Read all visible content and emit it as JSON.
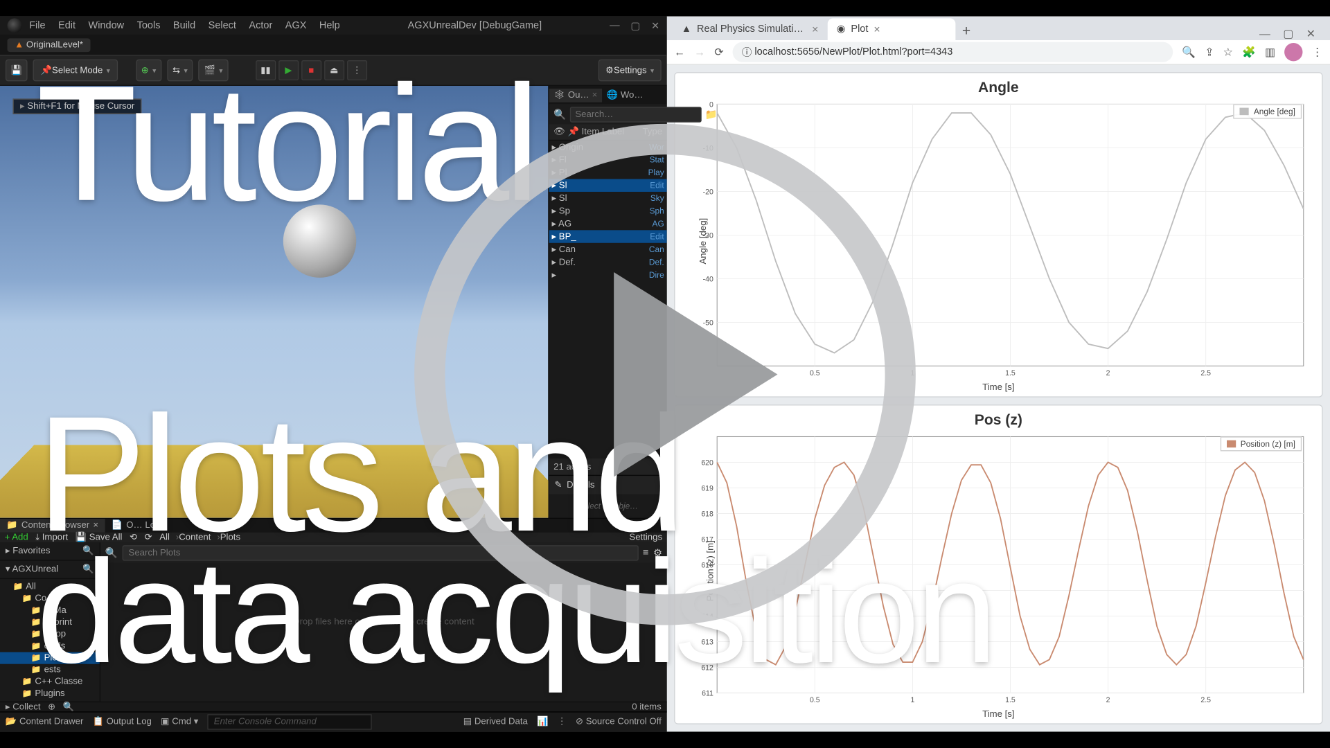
{
  "editor": {
    "menus": [
      "File",
      "Edit",
      "Window",
      "Tools",
      "Build",
      "Select",
      "Actor",
      "AGX",
      "Help"
    ],
    "app_title": "AGXUnrealDev [DebugGame]",
    "level_tab": "OriginalLevel*",
    "mode_btn": "Select Mode",
    "settings_btn": "Settings",
    "viewport_hint": "Shift+F1 for Mouse Cursor"
  },
  "outliner": {
    "tab1": "Ou…",
    "tab2": "Wo…",
    "search_placeholder": "Search…",
    "col_label": "Item Label",
    "col_type": "Type",
    "items": [
      {
        "l": "Origin",
        "t": "Wor"
      },
      {
        "l": "Fl",
        "t": "Stat"
      },
      {
        "l": "Pl",
        "t": "Play"
      },
      {
        "l": "Sl",
        "t": "Edit",
        "sel": true
      },
      {
        "l": "Sl",
        "t": "Sky"
      },
      {
        "l": "Sp",
        "t": "Sph"
      },
      {
        "l": "AG",
        "t": "AG"
      },
      {
        "l": "BP_",
        "t": "Edit",
        "sel": true
      },
      {
        "l": "Can",
        "t": "Can"
      },
      {
        "l": "Def.",
        "t": "Def."
      },
      {
        "l": "",
        "t": "Dire"
      }
    ],
    "count": "21 actors",
    "details": "Details",
    "details_msg": "Select an obje…"
  },
  "cb": {
    "tab1": "Content Browser",
    "tab2": "O…   Log",
    "add": "Add",
    "import": "Import",
    "saveall": "Save All",
    "crumbs": [
      "All",
      "Content",
      "Plots"
    ],
    "settings": "Settings",
    "favorites": "Favorites",
    "root": "AGXUnreal",
    "tree": [
      "All",
      "Co",
      "gxMa",
      "ueprint",
      "velop",
      "evels",
      "Plots",
      "ests",
      "C++ Classe",
      "Plugins"
    ],
    "tree_sel": "Plots",
    "search_placeholder": "Search Plots",
    "empty": "Drop files here or right click to create content",
    "collect": "Collect",
    "items": "0 items"
  },
  "status": {
    "drawer": "Content Drawer",
    "output": "Output Log",
    "cmd": "Cmd",
    "cmd_placeholder": "Enter Console Command",
    "derived": "Derived Data",
    "scc": "Source Control Off"
  },
  "browser": {
    "tab_inactive": "Real Physics Simulations - Fast -",
    "tab_active": "Plot",
    "url": "localhost:5656/NewPlot/Plot.html?port=4343"
  },
  "overlay": {
    "line1": "Tutorial",
    "line2": "Plots and",
    "line3": "data acquisition"
  },
  "chart_data": [
    {
      "type": "line",
      "title": "Angle",
      "xlabel": "Time [s]",
      "ylabel": "Angle [deg]",
      "legend": "Angle [deg]",
      "legend_color": "#bdbdbd",
      "xlim": [
        0,
        3.0
      ],
      "ylim": [
        -60,
        0
      ],
      "x_ticks": [
        0.5,
        1,
        1.5,
        2,
        2.5
      ],
      "y_ticks": [
        0,
        -10,
        -20,
        -30,
        -40,
        -50
      ],
      "series": [
        {
          "name": "Angle [deg]",
          "color": "#bdbdbd",
          "x": [
            0.0,
            0.1,
            0.2,
            0.3,
            0.4,
            0.5,
            0.6,
            0.7,
            0.8,
            0.9,
            1.0,
            1.1,
            1.2,
            1.3,
            1.4,
            1.5,
            1.6,
            1.7,
            1.8,
            1.9,
            2.0,
            2.1,
            2.2,
            2.3,
            2.4,
            2.5,
            2.6,
            2.7,
            2.8,
            2.9,
            3.0
          ],
          "y": [
            -2,
            -10,
            -22,
            -36,
            -48,
            -55,
            -57,
            -54,
            -45,
            -32,
            -18,
            -8,
            -2,
            -2,
            -7,
            -16,
            -28,
            -40,
            -50,
            -55,
            -56,
            -52,
            -43,
            -31,
            -18,
            -8,
            -3,
            -2,
            -6,
            -14,
            -24
          ]
        }
      ]
    },
    {
      "type": "line",
      "title": "Pos (z)",
      "xlabel": "Time [s]",
      "ylabel": "Position (z) [m]",
      "legend": "Position (z) [m]",
      "legend_color": "#c98a6f",
      "xlim": [
        0,
        3.0
      ],
      "ylim": [
        611,
        621
      ],
      "x_ticks": [
        0.5,
        1,
        1.5,
        2,
        2.5
      ],
      "y_ticks": [
        611,
        612,
        613,
        614,
        615,
        616,
        617,
        618,
        619,
        620
      ],
      "series": [
        {
          "name": "Position (z) [m]",
          "color": "#c98a6f",
          "x": [
            0.0,
            0.05,
            0.1,
            0.15,
            0.2,
            0.25,
            0.3,
            0.35,
            0.4,
            0.45,
            0.5,
            0.55,
            0.6,
            0.65,
            0.7,
            0.75,
            0.8,
            0.85,
            0.9,
            0.95,
            1.0,
            1.05,
            1.1,
            1.15,
            1.2,
            1.25,
            1.3,
            1.35,
            1.4,
            1.45,
            1.5,
            1.55,
            1.6,
            1.65,
            1.7,
            1.75,
            1.8,
            1.85,
            1.9,
            1.95,
            2.0,
            2.05,
            2.1,
            2.15,
            2.2,
            2.25,
            2.3,
            2.35,
            2.4,
            2.45,
            2.5,
            2.55,
            2.6,
            2.65,
            2.7,
            2.75,
            2.8,
            2.85,
            2.9,
            2.95,
            3.0
          ],
          "y": [
            620.0,
            619.2,
            617.5,
            615.3,
            613.4,
            612.3,
            612.1,
            612.8,
            614.2,
            616.0,
            617.8,
            619.1,
            619.8,
            620.0,
            619.5,
            618.2,
            616.3,
            614.4,
            612.9,
            612.2,
            612.2,
            613.0,
            614.5,
            616.3,
            618.0,
            619.3,
            619.9,
            619.9,
            619.2,
            617.8,
            615.9,
            614.0,
            612.7,
            612.1,
            612.3,
            613.2,
            614.8,
            616.6,
            618.3,
            619.5,
            620.0,
            619.8,
            618.9,
            617.3,
            615.4,
            613.6,
            612.5,
            612.1,
            612.5,
            613.6,
            615.3,
            617.1,
            618.7,
            619.7,
            620.0,
            619.6,
            618.5,
            616.8,
            614.9,
            613.2,
            612.3
          ]
        }
      ]
    }
  ]
}
